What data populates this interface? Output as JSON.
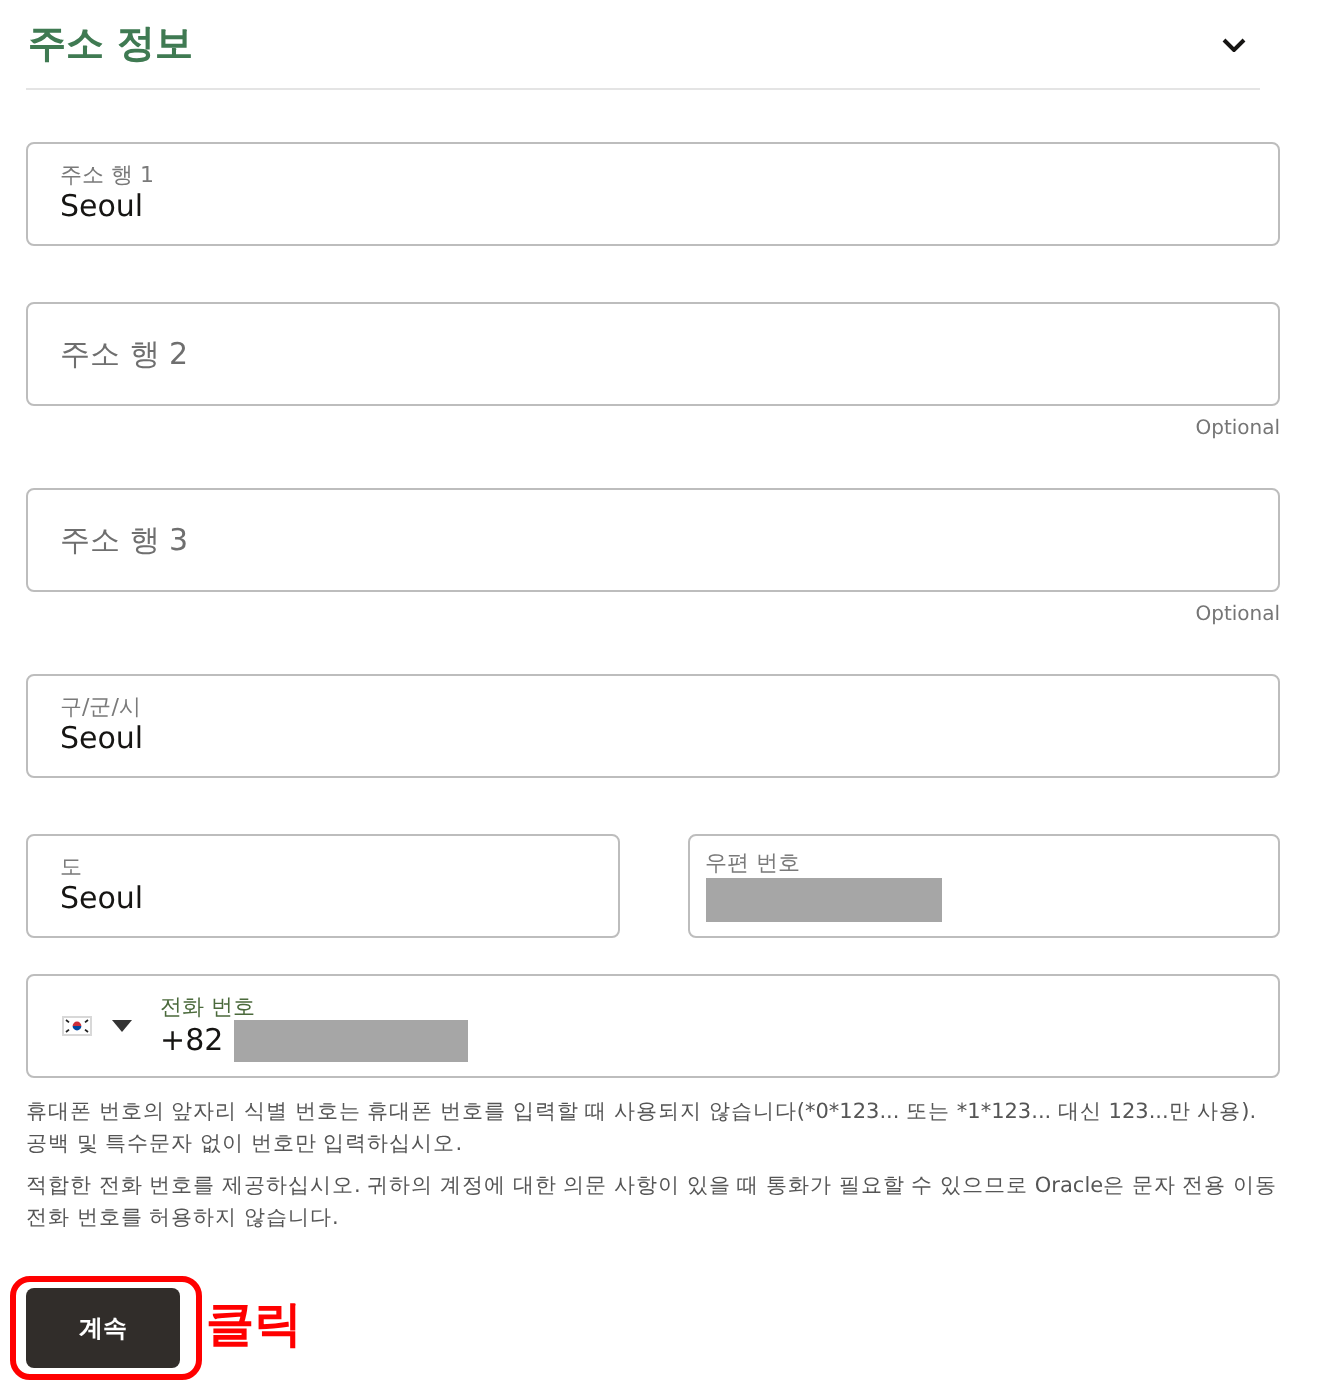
{
  "section": {
    "title": "주소 정보",
    "expanded": true
  },
  "address_fields": [
    {
      "label": "주소 행 1",
      "value": "Seoul"
    },
    {
      "placeholder": "주소 행 2",
      "note": "Optional"
    },
    {
      "placeholder": "주소 행 3",
      "note": "Optional"
    },
    {
      "label": "구/군/시",
      "value": "Seoul"
    }
  ],
  "region_fields": [
    {
      "label": "도",
      "value": "Seoul",
      "value_redacted": false
    },
    {
      "label": "우편 번호",
      "value_redacted": true
    }
  ],
  "phone": {
    "label": "전화 번호",
    "country_code": "+82",
    "number_redacted": true
  },
  "help_texts": [
    "휴대폰 번호의 앞자리 식별 번호는 휴대폰 번호를 입력할 때 사용되지 않습니다(*0*123... 또는 *1*123... 대신 123...만 사용). 공백 및 특수문자 없이 번호만 입력하십시오.",
    "적합한 전화 번호를 제공하십시오. 귀하의 계정에 대한 의문 사항이 있을 때 통화가 필요할 수 있으므로 Oracle은 문자 전용 이동 전화 번호를 허용하지 않습니다."
  ],
  "continue_button": {
    "label": "계속"
  },
  "annotation": {
    "text": "클릭",
    "outline": true
  }
}
